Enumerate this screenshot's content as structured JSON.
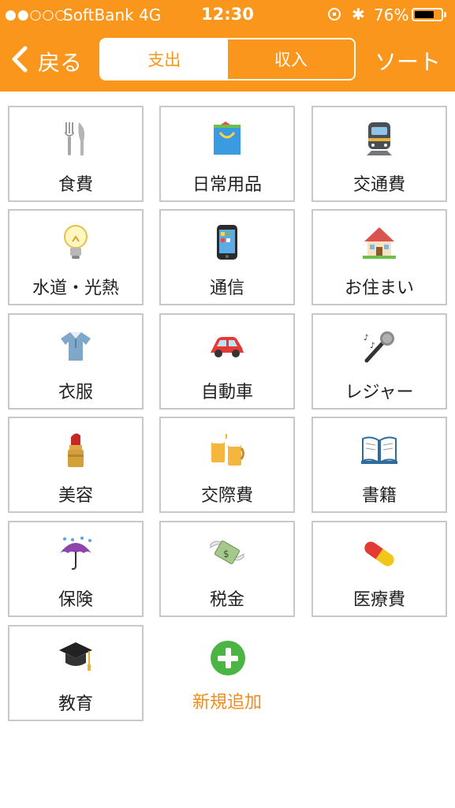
{
  "status_bar": {
    "signal": "●●○○○",
    "carrier": "SoftBank 4G",
    "time": "12:30",
    "battery_percent": "76%",
    "battery_level": 0.76
  },
  "nav": {
    "back_label": "戻る",
    "segments": [
      "支出",
      "収入"
    ],
    "selected_segment": "支出",
    "sort_label": "ソート"
  },
  "categories": [
    {
      "label": "食費",
      "icon": "fork-knife-icon"
    },
    {
      "label": "日常用品",
      "icon": "shopping-bag-icon"
    },
    {
      "label": "交通費",
      "icon": "train-icon"
    },
    {
      "label": "水道・光熱",
      "icon": "light-bulb-icon"
    },
    {
      "label": "通信",
      "icon": "mobile-phone-icon"
    },
    {
      "label": "お住まい",
      "icon": "house-icon"
    },
    {
      "label": "衣服",
      "icon": "shirt-icon"
    },
    {
      "label": "自動車",
      "icon": "car-icon"
    },
    {
      "label": "レジャー",
      "icon": "microphone-icon"
    },
    {
      "label": "美容",
      "icon": "lipstick-icon"
    },
    {
      "label": "交際費",
      "icon": "beer-mugs-icon"
    },
    {
      "label": "書籍",
      "icon": "open-book-icon"
    },
    {
      "label": "保険",
      "icon": "umbrella-rain-icon"
    },
    {
      "label": "税金",
      "icon": "money-wings-icon"
    },
    {
      "label": "医療費",
      "icon": "pill-icon"
    },
    {
      "label": "教育",
      "icon": "graduation-cap-icon"
    }
  ],
  "add_new": {
    "label": "新規追加",
    "icon": "plus-circle-icon"
  },
  "colors": {
    "accent": "#fb961c",
    "add_label": "#f18c1b",
    "tile_border": "#c8c8c8"
  }
}
